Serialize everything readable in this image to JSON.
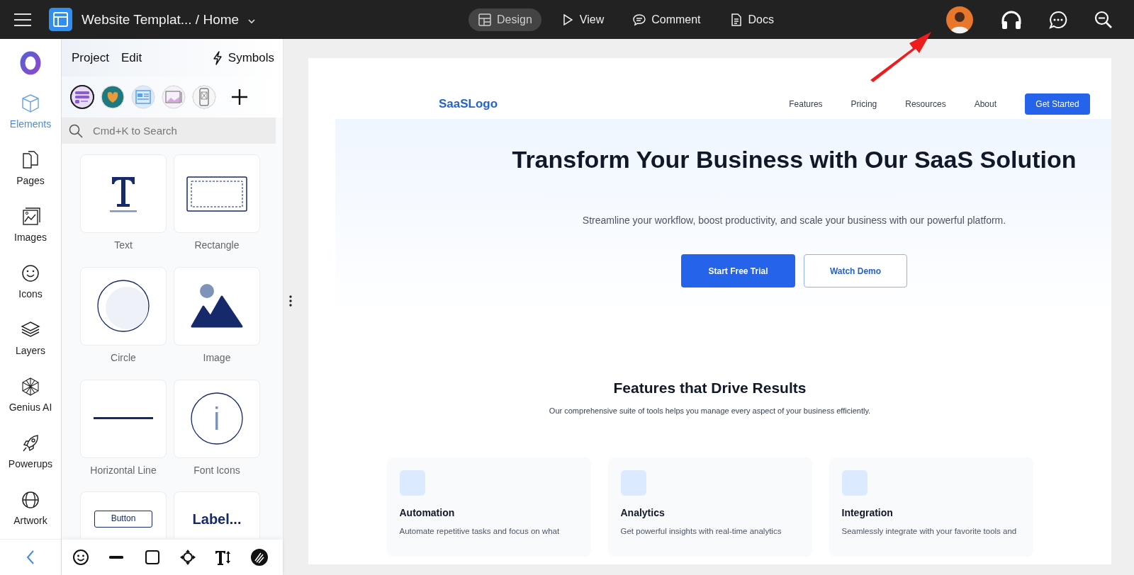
{
  "topbar": {
    "document_title": "Website Templat... / Home",
    "modes": [
      {
        "kind": "design",
        "label": "Design",
        "selected": true
      },
      {
        "kind": "view",
        "label": "View",
        "selected": false
      },
      {
        "kind": "comment",
        "label": "Comment",
        "selected": false
      },
      {
        "kind": "docs",
        "label": "Docs",
        "selected": false
      }
    ]
  },
  "rail": {
    "items": [
      {
        "kind": "elements",
        "label": "Elements",
        "selected": true
      },
      {
        "kind": "pages",
        "label": "Pages",
        "selected": false
      },
      {
        "kind": "images",
        "label": "Images",
        "selected": false
      },
      {
        "kind": "icons",
        "label": "Icons",
        "selected": false
      },
      {
        "kind": "layers",
        "label": "Layers",
        "selected": false
      },
      {
        "kind": "genius",
        "label": "Genius AI",
        "selected": false
      },
      {
        "kind": "powerups",
        "label": "Powerups",
        "selected": false
      },
      {
        "kind": "artwork",
        "label": "Artwork",
        "selected": false
      }
    ]
  },
  "panel": {
    "menus": [
      "Project",
      "Edit"
    ],
    "symbols": "Symbols",
    "templates": [
      {
        "kind": "list",
        "selected": true
      },
      {
        "kind": "photo",
        "selected": false
      },
      {
        "kind": "layout",
        "selected": false
      },
      {
        "kind": "gallery",
        "selected": false
      },
      {
        "kind": "mobile",
        "selected": false
      }
    ],
    "search": {
      "placeholder": "Cmd+K to Search"
    },
    "elements": [
      {
        "kind": "text",
        "label": "Text"
      },
      {
        "kind": "rectangle",
        "label": "Rectangle"
      },
      {
        "kind": "circle",
        "label": "Circle"
      },
      {
        "kind": "image",
        "label": "Image"
      },
      {
        "kind": "line",
        "label": "Horizontal Line"
      },
      {
        "kind": "font-icon",
        "label": "Font Icons"
      },
      {
        "kind": "button",
        "preview": "Button"
      },
      {
        "kind": "label",
        "preview": "Label..."
      }
    ]
  },
  "canvas": {
    "nav": {
      "logo": "SaaSLogo",
      "links": [
        "Features",
        "Pricing",
        "Resources",
        "About"
      ],
      "cta": "Get Started"
    },
    "hero": {
      "title": "Transform Your Business with Our SaaS Solution",
      "subtitle": "Streamline your workflow, boost productivity, and scale your business with our powerful platform.",
      "primary": "Start Free Trial",
      "secondary": "Watch Demo"
    },
    "features": {
      "title": "Features that Drive Results",
      "subtitle": "Our comprehensive suite of tools helps you manage every aspect of your business efficiently.",
      "cards": [
        {
          "title": "Automation",
          "text": "Automate repetitive tasks and focus on what"
        },
        {
          "title": "Analytics",
          "text": "Get powerful insights with real-time analytics"
        },
        {
          "title": "Integration",
          "text": "Seamlessly integrate with your favorite tools and"
        }
      ]
    }
  }
}
